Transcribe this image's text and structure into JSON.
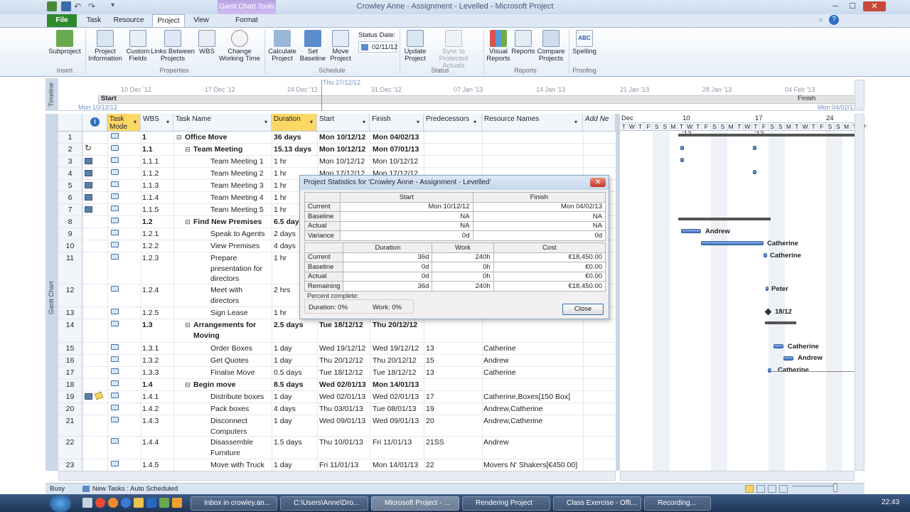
{
  "window": {
    "title": "Crowley Anne - Assignment - Levelled - Microsoft Project",
    "contextual_tab_group": "Gantt Chart Tools"
  },
  "tabs": [
    "File",
    "Task",
    "Resource",
    "Project",
    "View",
    "Format"
  ],
  "ribbon": {
    "groups": {
      "insert": "Insert",
      "properties": "Properties",
      "schedule": "Schedule",
      "status": "Status",
      "reports": "Reports",
      "proofing": "Proofing"
    },
    "buttons": {
      "subproject": "Subproject",
      "project_information": "Project Information",
      "custom_fields": "Custom Fields",
      "links_between_projects": "Links Between Projects",
      "wbs": "WBS",
      "change_working_time": "Change Working Time",
      "calculate_project": "Calculate Project",
      "set_baseline": "Set Baseline",
      "move_project": "Move Project",
      "status_date_label": "Status Date:",
      "status_date_value": "02/11/12",
      "update_project": "Update Project",
      "sync_to_protected_actuals": "Sync to Protected Actuals",
      "visual_reports": "Visual Reports",
      "reports": "Reports",
      "compare_projects": "Compare Projects",
      "spelling": "Spelling"
    }
  },
  "timeline": {
    "label": "Timeline",
    "current_date": "Thu 27/12/12",
    "start_label": "Start",
    "start_date": "Mon 10/12/12",
    "finish_label": "Finish",
    "finish_date": "Mon 04/02/13",
    "ticks": [
      "10 Dec '12",
      "17 Dec '12",
      "24 Dec '12",
      "31 Dec '12",
      "07 Jan '13",
      "14 Jan '13",
      "21 Jan '13",
      "28 Jan '13",
      "04 Feb '13"
    ]
  },
  "grid": {
    "side_label": "Gantt Chart",
    "columns": [
      "Task Mode",
      "WBS",
      "Task Name",
      "Duration",
      "Start",
      "Finish",
      "Predecessors",
      "Resource Names",
      "Add Ne"
    ],
    "rows": [
      {
        "n": "1",
        "wbs": "1",
        "name": "Office Move",
        "dur": "36 days",
        "start": "Mon 10/12/12",
        "finish": "Mon 04/02/13",
        "pred": "",
        "res": ""
      },
      {
        "n": "2",
        "wbs": "1.1",
        "name": "Team Meeting",
        "dur": "15.13 days",
        "start": "Mon 10/12/12",
        "finish": "Mon 07/01/13",
        "pred": "",
        "res": ""
      },
      {
        "n": "3",
        "wbs": "1.1.1",
        "name": "Team Meeting 1",
        "dur": "1 hr",
        "start": "Mon 10/12/12",
        "finish": "Mon 10/12/12",
        "pred": "",
        "res": ""
      },
      {
        "n": "4",
        "wbs": "1.1.2",
        "name": "Team Meeting 2",
        "dur": "1 hr",
        "start": "Mon 17/12/12",
        "finish": "Mon 17/12/12",
        "pred": "",
        "res": ""
      },
      {
        "n": "5",
        "wbs": "1.1.3",
        "name": "Team Meeting 3",
        "dur": "1 hr",
        "start": "",
        "finish": "",
        "pred": "",
        "res": ""
      },
      {
        "n": "6",
        "wbs": "1.1.4",
        "name": "Team Meeting 4",
        "dur": "1 hr",
        "start": "",
        "finish": "",
        "pred": "",
        "res": ""
      },
      {
        "n": "7",
        "wbs": "1.1.5",
        "name": "Team Meeting 5",
        "dur": "1 hr",
        "start": "",
        "finish": "",
        "pred": "",
        "res": ""
      },
      {
        "n": "8",
        "wbs": "1.2",
        "name": "Find New Premises",
        "dur": "6.5 days",
        "start": "",
        "finish": "",
        "pred": "",
        "res": ""
      },
      {
        "n": "9",
        "wbs": "1.2.1",
        "name": "Speak to Agents",
        "dur": "2 days",
        "start": "",
        "finish": "",
        "pred": "",
        "res": ""
      },
      {
        "n": "10",
        "wbs": "1.2.2",
        "name": "View Premises",
        "dur": "4 days",
        "start": "",
        "finish": "",
        "pred": "",
        "res": ""
      },
      {
        "n": "11",
        "wbs": "1.2.3",
        "name": "Prepare presentation for directors",
        "dur": "1 hr",
        "start": "",
        "finish": "",
        "pred": "",
        "res": ""
      },
      {
        "n": "12",
        "wbs": "1.2.4",
        "name": "Meet with directors",
        "dur": "2 hrs",
        "start": "",
        "finish": "",
        "pred": "",
        "res": ""
      },
      {
        "n": "13",
        "wbs": "1.2.5",
        "name": "Sign Lease",
        "dur": "1 hr",
        "start": "",
        "finish": "",
        "pred": "",
        "res": ""
      },
      {
        "n": "14",
        "wbs": "1.3",
        "name": "Arrangements for Moving",
        "dur": "2.5 days",
        "start": "Tue 18/12/12",
        "finish": "Thu 20/12/12",
        "pred": "",
        "res": ""
      },
      {
        "n": "15",
        "wbs": "1.3.1",
        "name": "Order Boxes",
        "dur": "1 day",
        "start": "Wed 19/12/12",
        "finish": "Wed 19/12/12",
        "pred": "13",
        "res": "Catherine"
      },
      {
        "n": "16",
        "wbs": "1.3.2",
        "name": "Get Quotes",
        "dur": "1 day",
        "start": "Thu 20/12/12",
        "finish": "Thu 20/12/12",
        "pred": "15",
        "res": "Andrew"
      },
      {
        "n": "17",
        "wbs": "1.3.3",
        "name": "Finalse Move dates",
        "dur": "0.5 days",
        "start": "Tue 18/12/12",
        "finish": "Tue 18/12/12",
        "pred": "13",
        "res": "Catherine"
      },
      {
        "n": "18",
        "wbs": "1.4",
        "name": "Begin move",
        "dur": "8.5 days",
        "start": "Wed 02/01/13",
        "finish": "Mon 14/01/13",
        "pred": "",
        "res": ""
      },
      {
        "n": "19",
        "wbs": "1.4.1",
        "name": "Distribute boxes",
        "dur": "1 day",
        "start": "Wed 02/01/13",
        "finish": "Wed 02/01/13",
        "pred": "17",
        "res": "Catherine,Boxes[150 Box]"
      },
      {
        "n": "20",
        "wbs": "1.4.2",
        "name": "Pack boxes",
        "dur": "4 days",
        "start": "Thu 03/01/13",
        "finish": "Tue 08/01/13",
        "pred": "19",
        "res": "Andrew,Catherine"
      },
      {
        "n": "21",
        "wbs": "1.4.3",
        "name": "Disconnect Computers",
        "dur": "1 day",
        "start": "Wed 09/01/13",
        "finish": "Wed 09/01/13",
        "pred": "20",
        "res": "Andrew,Catherine"
      },
      {
        "n": "22",
        "wbs": "1.4.4",
        "name": "Disassemble Furniture",
        "dur": "1.5 days",
        "start": "Thu 10/01/13",
        "finish": "Fri 11/01/13",
        "pred": "21SS",
        "res": "Andrew"
      },
      {
        "n": "23",
        "wbs": "1.4.5",
        "name": "Move with Truck",
        "dur": "1 day",
        "start": "Fri 11/01/13",
        "finish": "Mon 14/01/13",
        "pred": "22",
        "res": "Movers N' Shakers[€450.00]"
      }
    ]
  },
  "gantt": {
    "weeks": [
      "Dec '12",
      "10 Dec '12",
      "17 Dec '12",
      "24 Dec '1"
    ],
    "days": [
      "T",
      "W",
      "T",
      "F",
      "S",
      "S",
      "M",
      "T",
      "W",
      "T",
      "F",
      "S",
      "S",
      "M",
      "T",
      "W",
      "T",
      "F",
      "S",
      "S",
      "M",
      "T",
      "W",
      "T",
      "F",
      "S",
      "S",
      "M",
      "T",
      "W"
    ],
    "labels": [
      "Andrew",
      "Catherine",
      "Catherine",
      "Peter",
      "18/12",
      "Catherine",
      "Andrew",
      "Catherine"
    ]
  },
  "dialog": {
    "title": "Project Statistics for 'Crowley Anne - Assignment - Levelled'",
    "dates_headers": [
      "Start",
      "Finish"
    ],
    "dates_rows": [
      {
        "label": "Current",
        "start": "Mon 10/12/12",
        "finish": "Mon 04/02/13"
      },
      {
        "label": "Baseline",
        "start": "NA",
        "finish": "NA"
      },
      {
        "label": "Actual",
        "start": "NA",
        "finish": "NA"
      },
      {
        "label": "Variance",
        "start": "0d",
        "finish": "0d"
      }
    ],
    "totals_headers": [
      "Duration",
      "Work",
      "Cost"
    ],
    "totals_rows": [
      {
        "label": "Current",
        "dur": "36d",
        "work": "240h",
        "cost": "€18,450.00"
      },
      {
        "label": "Baseline",
        "dur": "0d",
        "work": "0h",
        "cost": "€0.00"
      },
      {
        "label": "Actual",
        "dur": "0d",
        "work": "0h",
        "cost": "€0.00"
      },
      {
        "label": "Remaining",
        "dur": "36d",
        "work": "240h",
        "cost": "€18,450.00"
      }
    ],
    "percent_complete": "Percent complete:",
    "duration_pct": "Duration:  0%",
    "work_pct": "Work:  0%",
    "close": "Close"
  },
  "statusbar": {
    "mode": "Busy",
    "new_tasks": "New Tasks : Auto Scheduled"
  },
  "taskbar": {
    "items": [
      "Inbox in crowley.an...",
      "C:\\Users\\Anne\\Dro...",
      "Microsoft Project - ...",
      "Rendering Project",
      "Class Exercise - Offi...",
      "Recording..."
    ],
    "clock": "22:43"
  }
}
